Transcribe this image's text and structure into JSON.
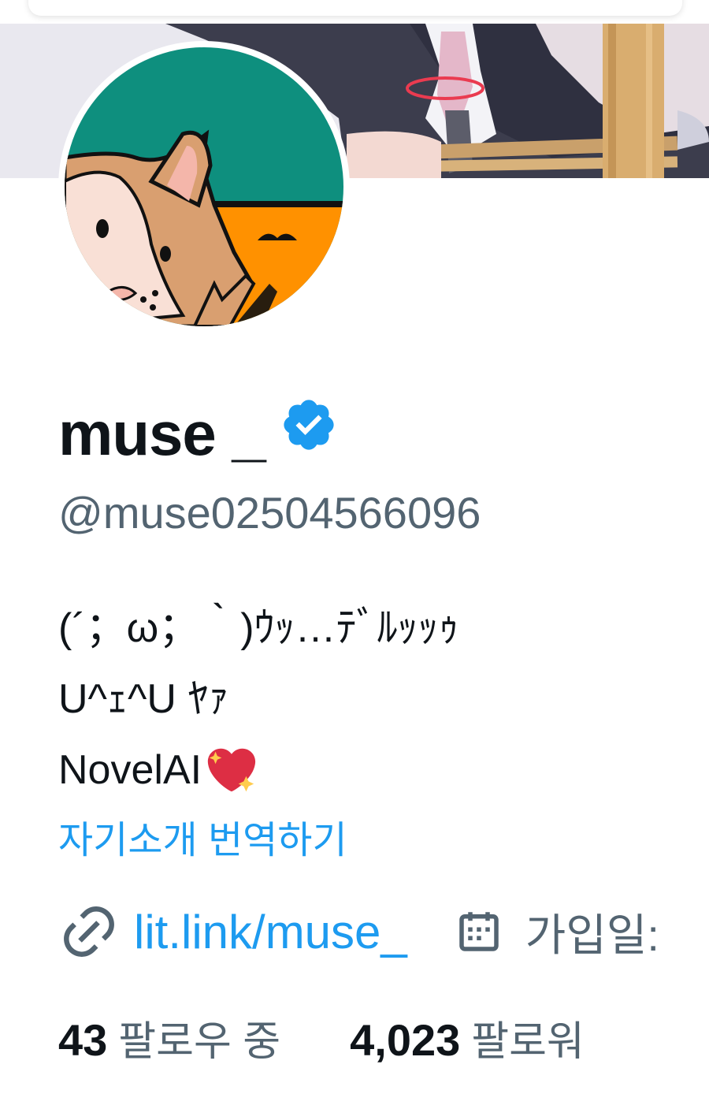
{
  "profile": {
    "display_name": "muse _",
    "handle": "@muse02504566096",
    "verified_icon": "verified-badge-icon",
    "bio": [
      "(´；ω；｀)ｳｯ…ﾃﾞﾙｯｯｩ",
      "U^ｪ^U ﾔｧ",
      "NovelAI"
    ],
    "bio_emoji": "sparkling-heart-icon",
    "translate_label": "자기소개 번역하기",
    "website": "lit.link/muse_",
    "joined_label": "가입일:",
    "following_count": "43",
    "following_label": "팔로우 중",
    "followers_count": "4,023",
    "followers_label": "팔로워"
  },
  "colors": {
    "link": "#1d9bf0",
    "secondary_text": "#536471",
    "primary_text": "#0f1419",
    "verified": "#1d9bf0",
    "avatar_teal": "#0e8f7e",
    "avatar_orange": "#ff9100"
  },
  "icons": {
    "link": "link-icon",
    "calendar": "calendar-icon"
  }
}
